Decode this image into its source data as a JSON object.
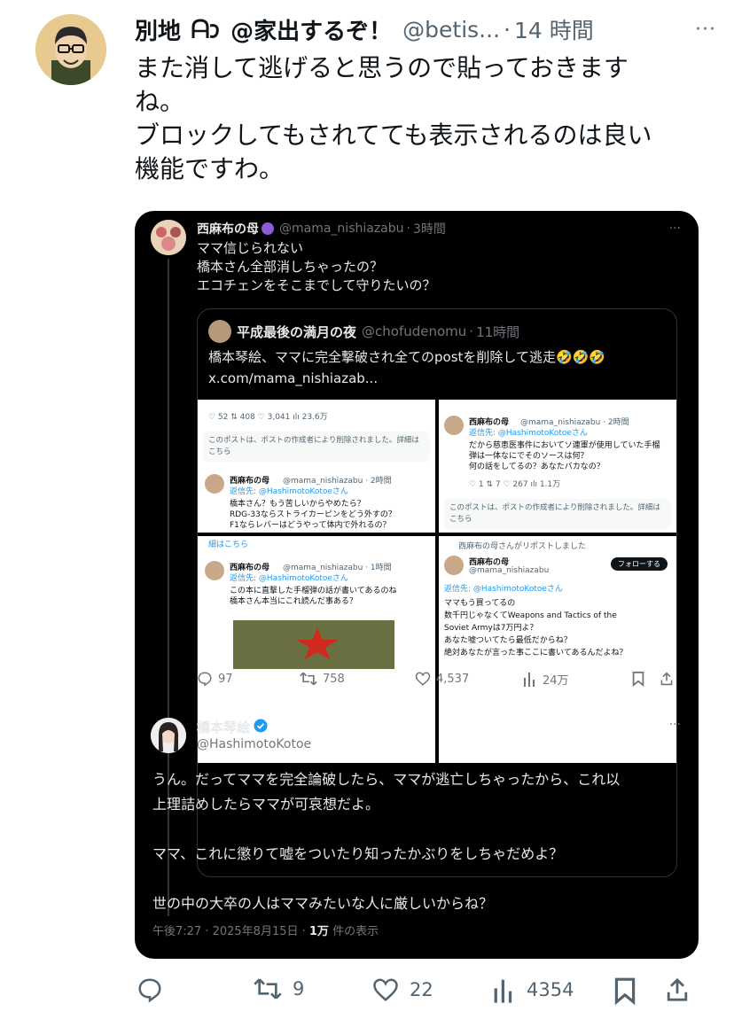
{
  "post": {
    "author_name": "別地",
    "author_name_suffix": "@家出するぞ！",
    "author_handle": "@betis...",
    "time": "14 時間",
    "more": "···",
    "text_lines": [
      "また消して逃げると思うので貼っておきます",
      "ね。",
      "ブロックしてもされてても表示されるのは良い",
      "機能ですわ。"
    ],
    "actions": {
      "reply_count": "",
      "repost_count": "9",
      "like_count": "22",
      "views_count": "4354"
    }
  },
  "quote1": {
    "author_name": "西麻布の母",
    "author_handle": "@mama_nishiazabu",
    "time": "3時間",
    "more": "···",
    "text_lines": [
      "ママ信じられない",
      "橋本さん全部消しちゃったの？",
      "エコチェンをそこまでして守りたいの？"
    ],
    "inner": {
      "author_name": "平成最後の満月の夜",
      "author_handle": "@chofudenomu",
      "time": "11時間",
      "text_lines": [
        "橋本琴絵、ママに完全撃破され全てのpostを削除して逃走🤣🤣🤣",
        "x.com/mama_nishiazab..."
      ],
      "tiles": {
        "tl": {
          "stats": "♡ 52    ⇅ 408    ♡ 3,041    ılı 23.6万",
          "deleted": "このポストは、ポストの作成者により削除されました。詳細はこちら",
          "name": "西麻布の母",
          "handle": "@mama_nishiazabu · 2時間",
          "reply_to": "返信先: @HashimotoKotoeさん",
          "lines": [
            "橋本さん？もう苦しいからやめたら？",
            "RDG-33ならストライカーピンをどう外すの？",
            "F1ならレバーはどうやって体内で外れるの？"
          ]
        },
        "tr": {
          "name": "西麻布の母",
          "handle": "@mama_nishiazabu · 2時間",
          "reply_to": "返信先: @HashimotoKotoeさん",
          "lines": [
            "だから慈恵医事件においてソ連軍が使用していた手榴",
            "弾は一体なにでそのソースは何？",
            "何の話をしてるの？あなたバカなの？"
          ],
          "stats": "♡ 1    ⇅ 7    ♡ 267    ılı 1.1万",
          "deleted": "このポストは、ポストの作成者により削除されました。詳細はこちら"
        },
        "bl": {
          "top": "細はこちら",
          "name": "西麻布の母",
          "handle": "@mama_nishiazabu · 1時間",
          "reply_to": "返信先: @HashimotoKotoeさん",
          "lines": [
            "この本に直撃した手榴弾の話が書いてあるのね",
            "橋本さん本当にこれ読んだ事ある？"
          ]
        },
        "br": {
          "repost": "西麻布の母さんがリポストしました",
          "name": "西麻布の母",
          "handle": "@mama_nishiazabu",
          "follow": "フォローする",
          "reply_to": "返信先: @HashimotoKotoeさん",
          "lines": [
            "ママもう買ってるの",
            "数千円じゃなくてWeapons and Tactics of the",
            "Soviet Armyは7万円よ？",
            "あなた嘘ついてたら最低だからね？",
            "絶対あなたが言った事ここに書いてあるんだよね？"
          ]
        }
      }
    },
    "actions": {
      "replies": "97",
      "reposts": "758",
      "likes": "4,537",
      "views": "24万"
    }
  },
  "quote2": {
    "author_name": "橋本琴絵",
    "author_handle": "@HashimotoKotoe",
    "more": "···",
    "text_lines": [
      "うん。だってママを完全論破したら、ママが逃亡しちゃったから、これ以",
      "上理詰めしたらママが可哀想だよ。",
      "",
      "ママ、これに懲りて嘘をついたり知ったかぶりをしちゃだめよ？",
      "",
      "世の中の大卒の人はママみたいな人に厳しいからね？"
    ],
    "meta_date": "午後7:27 · 2025年8月15日 · ",
    "meta_views": "1万",
    "meta_suffix": " 件の表示"
  },
  "colors": {
    "accent": "#1d9bf0",
    "dark_bg": "#000000",
    "muted": "#536471"
  }
}
